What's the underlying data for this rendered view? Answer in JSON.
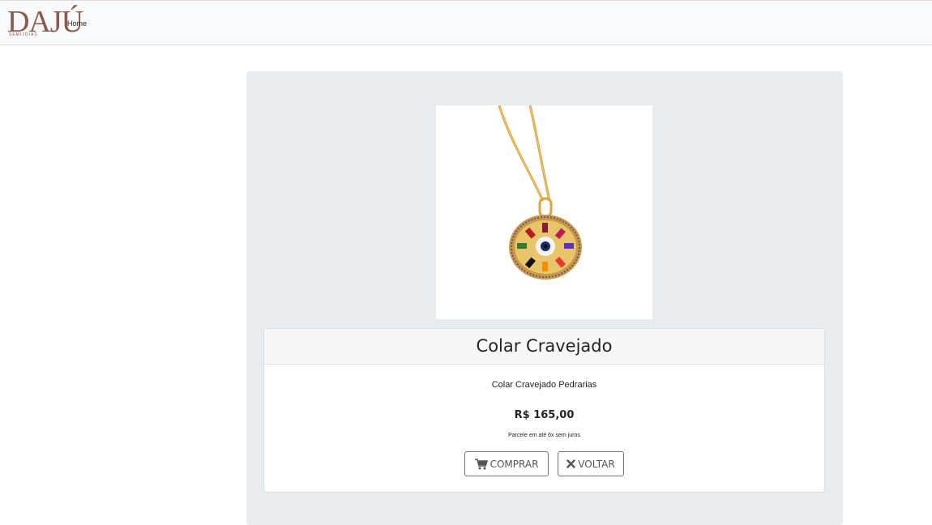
{
  "navbar": {
    "logo_text": "DAJÚ",
    "logo_subtext": "SEMIJOIAS",
    "home_link": "Home"
  },
  "product": {
    "title": "Colar Cravejado",
    "description": "Colar Cravejado Pedrarias",
    "price": "R$ 165,00",
    "installments": "Parcele em até 6x sem juros",
    "buy_label": "COMPRAR",
    "back_label": "VOLTAR"
  },
  "icons": {
    "buy": "cart-icon",
    "back": "close-icon"
  },
  "colors": {
    "brand": "#8a5a4d",
    "panel_bg": "#e9ecef",
    "button_border": "#6c757d"
  }
}
